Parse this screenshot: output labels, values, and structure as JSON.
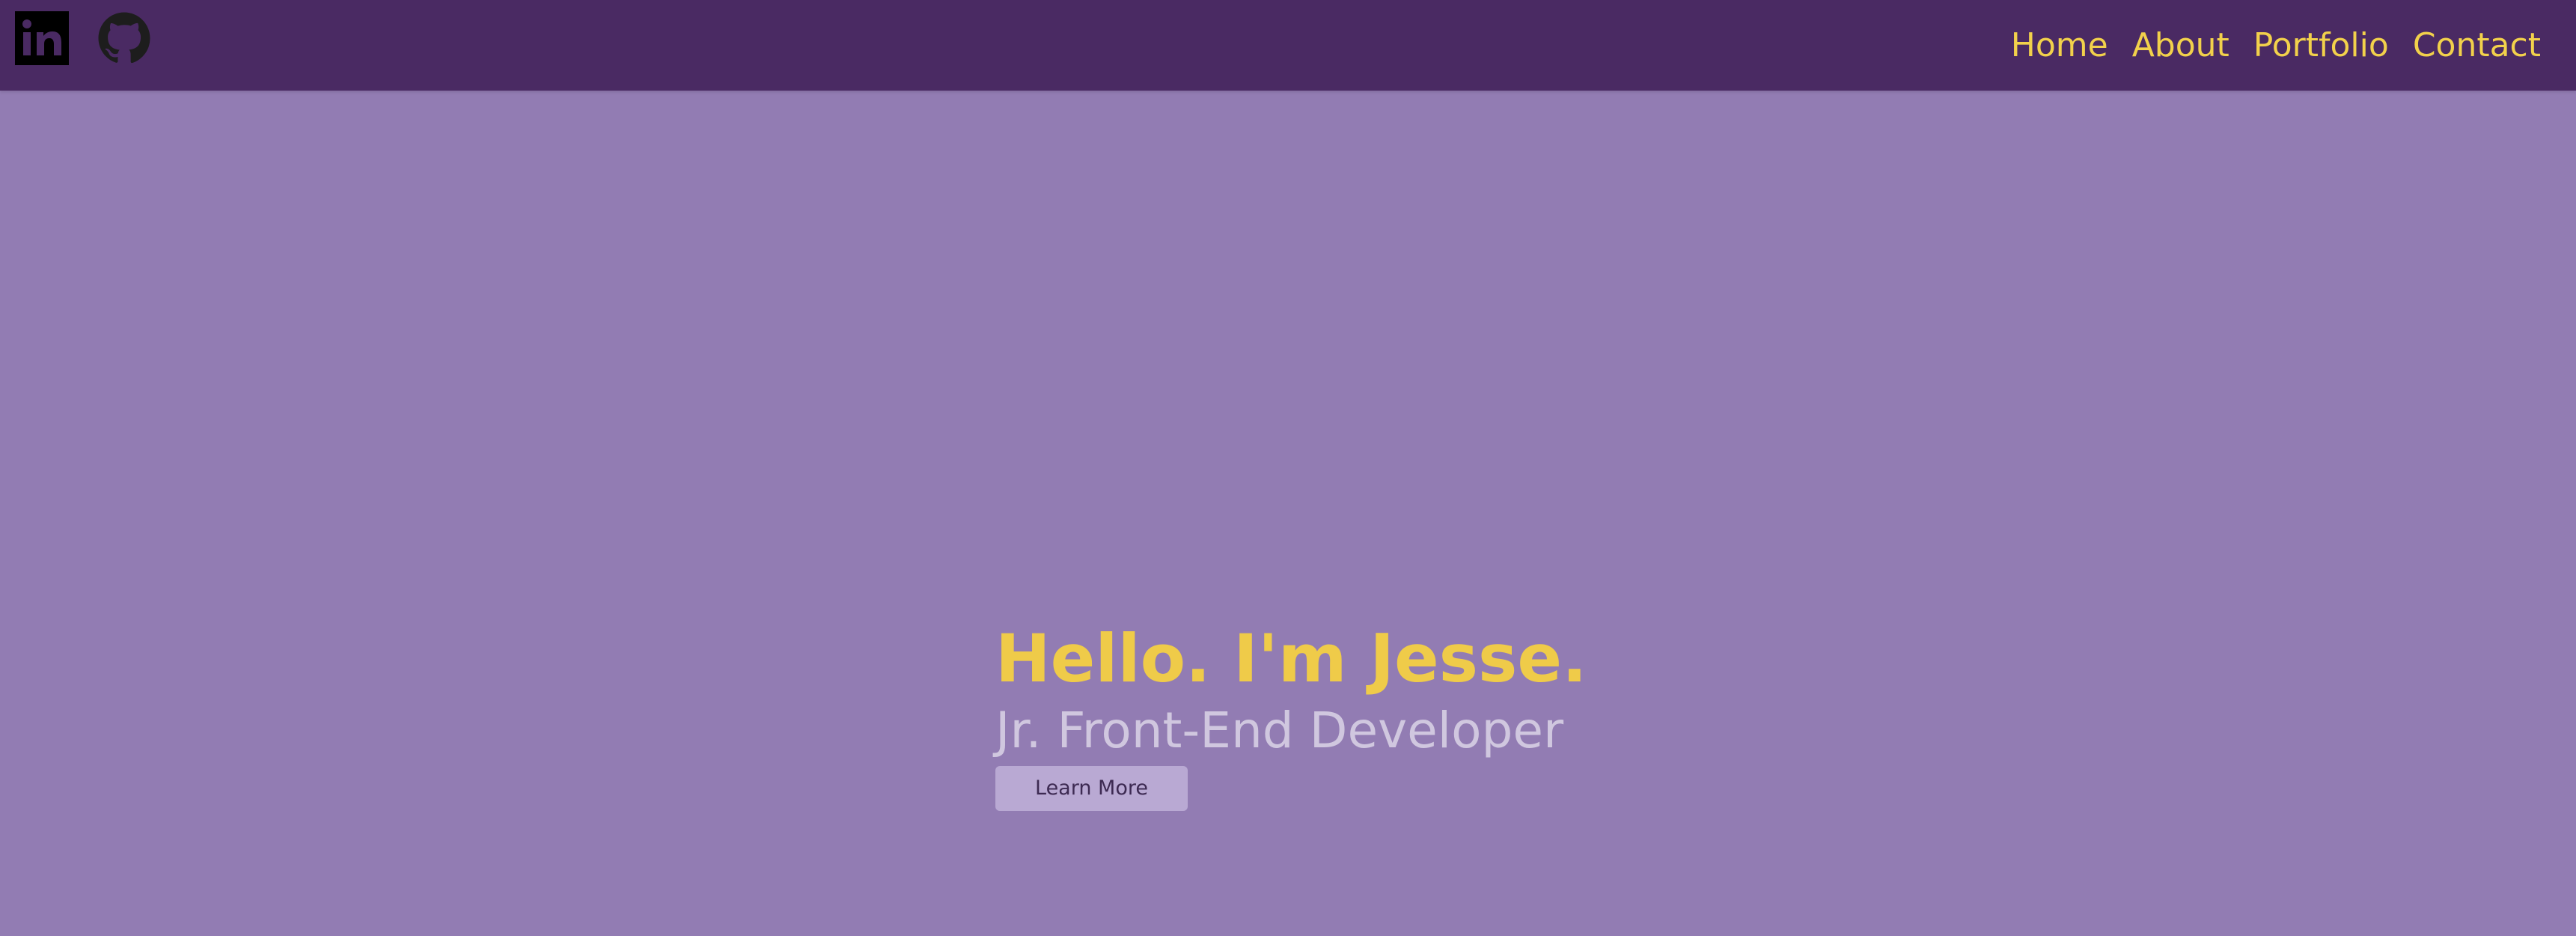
{
  "nav": {
    "social": {
      "linkedin_icon": "linkedin-icon",
      "github_icon": "github-icon"
    },
    "links": [
      "Home",
      "About",
      "Portfolio",
      "Contact"
    ]
  },
  "hero": {
    "greeting": "Hello. I'm Jesse.",
    "subtitle": "Jr. Front-End Developer",
    "button_label": "Learn More"
  },
  "colors": {
    "navbar": "#4a2a63",
    "background": "#927cb3",
    "accent": "#efcb49",
    "subtitle": "#d0c7df",
    "button": "#b9a9d3"
  }
}
